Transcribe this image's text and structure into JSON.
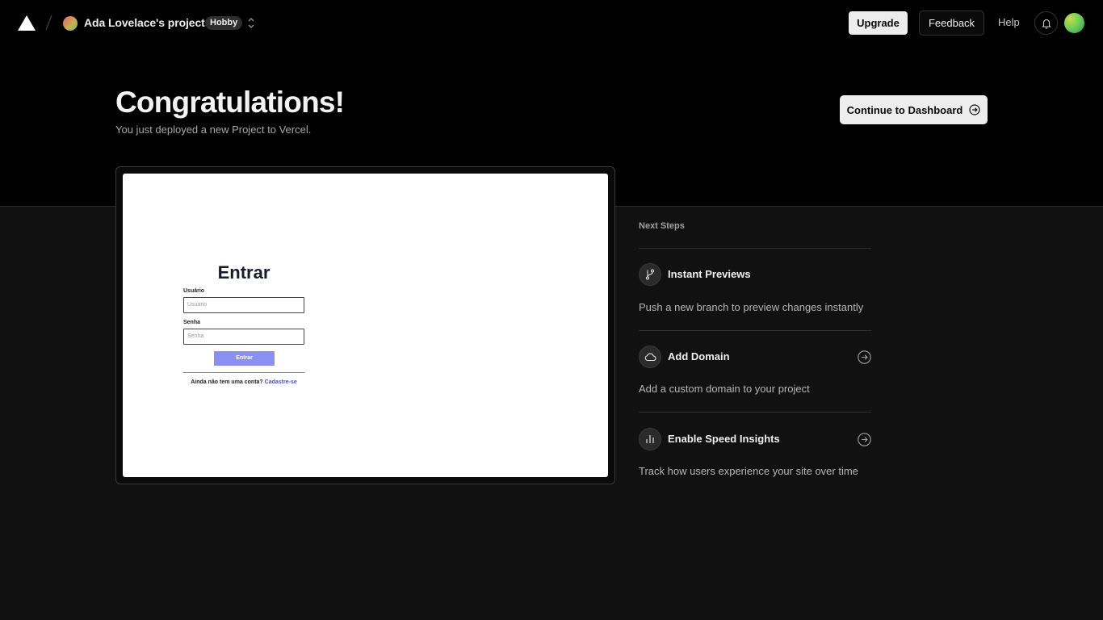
{
  "header": {
    "team_name": "Ada Lovelace's projects",
    "plan_badge": "Hobby",
    "upgrade_label": "Upgrade",
    "feedback_label": "Feedback",
    "help_label": "Help"
  },
  "hero": {
    "title": "Congratulations!",
    "subtitle": "You just deployed a new Project to Vercel.",
    "cta_label": "Continue to Dashboard"
  },
  "preview": {
    "title": "Entrar",
    "username_label": "Usuário",
    "username_placeholder": "Usuario",
    "password_label": "Senha",
    "password_placeholder": "Senha",
    "submit_label": "Entrar",
    "footer_text": "Ainda não tem uma conta?",
    "footer_link": "Cadastre-se"
  },
  "next_steps": {
    "heading": "Next Steps",
    "items": [
      {
        "icon": "git-branch-icon",
        "title": "Instant Previews",
        "description": "Push a new branch to preview changes instantly",
        "has_arrow": false
      },
      {
        "icon": "cloud-icon",
        "title": "Add Domain",
        "description": "Add a custom domain to your project",
        "has_arrow": true
      },
      {
        "icon": "bar-chart-icon",
        "title": "Enable Speed Insights",
        "description": "Track how users experience your site over time",
        "has_arrow": true
      }
    ]
  },
  "colors": {
    "background": "#111111",
    "header_background": "#000000",
    "primary_button": "#ededed",
    "preview_button": "#8a8ff0",
    "preview_link": "#4a4adb"
  }
}
